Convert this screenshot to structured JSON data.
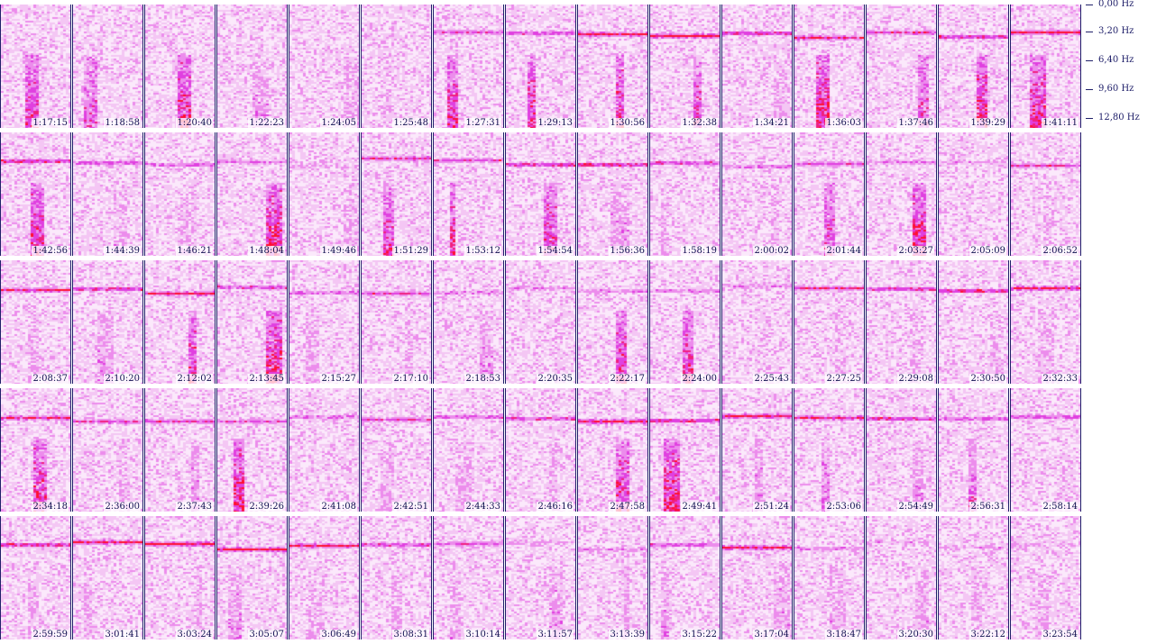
{
  "chart_data": {
    "type": "heatmap",
    "title": "",
    "colors": {
      "background": "#fbe9fb",
      "low": "#f4c6f4",
      "mid": "#e040e0",
      "high": "#ff1030",
      "frame": "#20206a",
      "text": "#101050"
    },
    "freq_axis": {
      "ticks": [
        "0,00 Hz",
        "3,20 Hz",
        "6,40 Hz",
        "9,60 Hz",
        "12,80 Hz"
      ],
      "range": [
        0,
        12.8
      ]
    },
    "rows": [
      {
        "labels": [
          "1:17:15",
          "1:18:58",
          "1:20:40",
          "1:22:23",
          "1:24:05",
          "1:25:48",
          "1:27:31",
          "1:29:13",
          "1:30:56",
          "1:32:38",
          "1:34:21",
          "1:36:03",
          "1:37:46",
          "1:39:29",
          "1:41:11"
        ],
        "band": [
          0.0,
          0.0,
          0.0,
          0.0,
          0.0,
          0.1,
          0.5,
          0.6,
          0.9,
          1.0,
          0.8,
          0.8,
          0.7,
          0.8,
          0.9
        ],
        "burst": [
          0.7,
          0.5,
          0.9,
          0.3,
          0.2,
          0.1,
          0.8,
          0.8,
          0.8,
          0.7,
          0.2,
          0.9,
          0.6,
          0.9,
          0.8
        ]
      },
      {
        "labels": [
          "1:42:56",
          "1:44:39",
          "1:46:21",
          "1:48:04",
          "1:49:46",
          "1:51:29",
          "1:53:12",
          "1:54:54",
          "1:56:36",
          "1:58:19",
          "2:00:02",
          "2:01:44",
          "2:03:27",
          "2:05:09",
          "2:06:52"
        ],
        "band": [
          0.9,
          0.6,
          0.5,
          0.4,
          0.2,
          0.6,
          0.6,
          0.8,
          0.9,
          0.7,
          0.5,
          0.5,
          0.4,
          0.2,
          0.6
        ],
        "burst": [
          0.8,
          0.2,
          0.2,
          0.9,
          0.2,
          0.7,
          0.8,
          0.7,
          0.3,
          0.2,
          0.2,
          0.6,
          0.9,
          0.1,
          0.1
        ]
      },
      {
        "labels": [
          "2:08:37",
          "2:10:20",
          "2:12:02",
          "2:13:45",
          "2:15:27",
          "2:17:10",
          "2:18:53",
          "2:20:35",
          "2:22:17",
          "2:24:00",
          "2:25:43",
          "2:27:25",
          "2:29:08",
          "2:30:50",
          "2:32:33"
        ],
        "band": [
          0.8,
          0.8,
          0.8,
          0.7,
          0.5,
          0.6,
          0.4,
          0.3,
          0.4,
          0.4,
          0.3,
          0.7,
          0.8,
          0.9,
          0.9
        ],
        "burst": [
          0.2,
          0.3,
          0.8,
          0.9,
          0.2,
          0.2,
          0.3,
          0.1,
          0.8,
          0.8,
          0.1,
          0.1,
          0.1,
          0.2,
          0.2
        ]
      },
      {
        "labels": [
          "2:34:18",
          "2:36:00",
          "2:37:43",
          "2:39:26",
          "2:41:08",
          "2:42:51",
          "2:44:33",
          "2:46:16",
          "2:47:58",
          "2:49:41",
          "2:51:24",
          "2:53:06",
          "2:54:49",
          "2:56:31",
          "2:58:14"
        ],
        "band": [
          0.8,
          0.6,
          0.6,
          0.5,
          0.5,
          0.6,
          0.6,
          0.7,
          0.9,
          0.9,
          0.9,
          0.8,
          0.8,
          0.6,
          0.6
        ],
        "burst": [
          0.8,
          0.2,
          0.3,
          0.9,
          0.1,
          0.2,
          0.2,
          0.2,
          0.8,
          0.9,
          0.3,
          0.4,
          0.3,
          0.5,
          0.1
        ]
      },
      {
        "labels": [
          "2:59:59",
          "3:01:41",
          "3:03:24",
          "3:05:07",
          "3:06:49",
          "3:08:31",
          "3:10:14",
          "3:11:57",
          "3:13:39",
          "3:15:22",
          "3:17:04",
          "3:18:47",
          "3:20:30",
          "3:22:12",
          "3:23:54"
        ],
        "band": [
          0.9,
          0.9,
          1.0,
          1.0,
          0.8,
          0.7,
          0.5,
          0.2,
          0.3,
          0.6,
          0.8,
          0.4,
          0.2,
          0.2,
          0.2
        ],
        "burst": [
          0.2,
          0.2,
          0.3,
          0.3,
          0.2,
          0.2,
          0.2,
          0.3,
          0.2,
          0.3,
          0.3,
          0.2,
          0.2,
          0.2,
          0.2
        ]
      }
    ]
  }
}
